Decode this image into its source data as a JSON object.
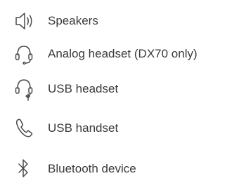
{
  "devices": [
    {
      "label": "Speakers",
      "icon": "speaker-icon"
    },
    {
      "label": "Analog headset (DX70 only)",
      "icon": "headset-icon"
    },
    {
      "label": "USB headset",
      "icon": "usb-headset-icon"
    },
    {
      "label": "USB handset",
      "icon": "handset-icon"
    },
    {
      "label": "Bluetooth device",
      "icon": "bluetooth-icon"
    }
  ],
  "colors": {
    "text": "#3a3a3a",
    "icon": "#4a4a4a",
    "background": "#ffffff"
  }
}
